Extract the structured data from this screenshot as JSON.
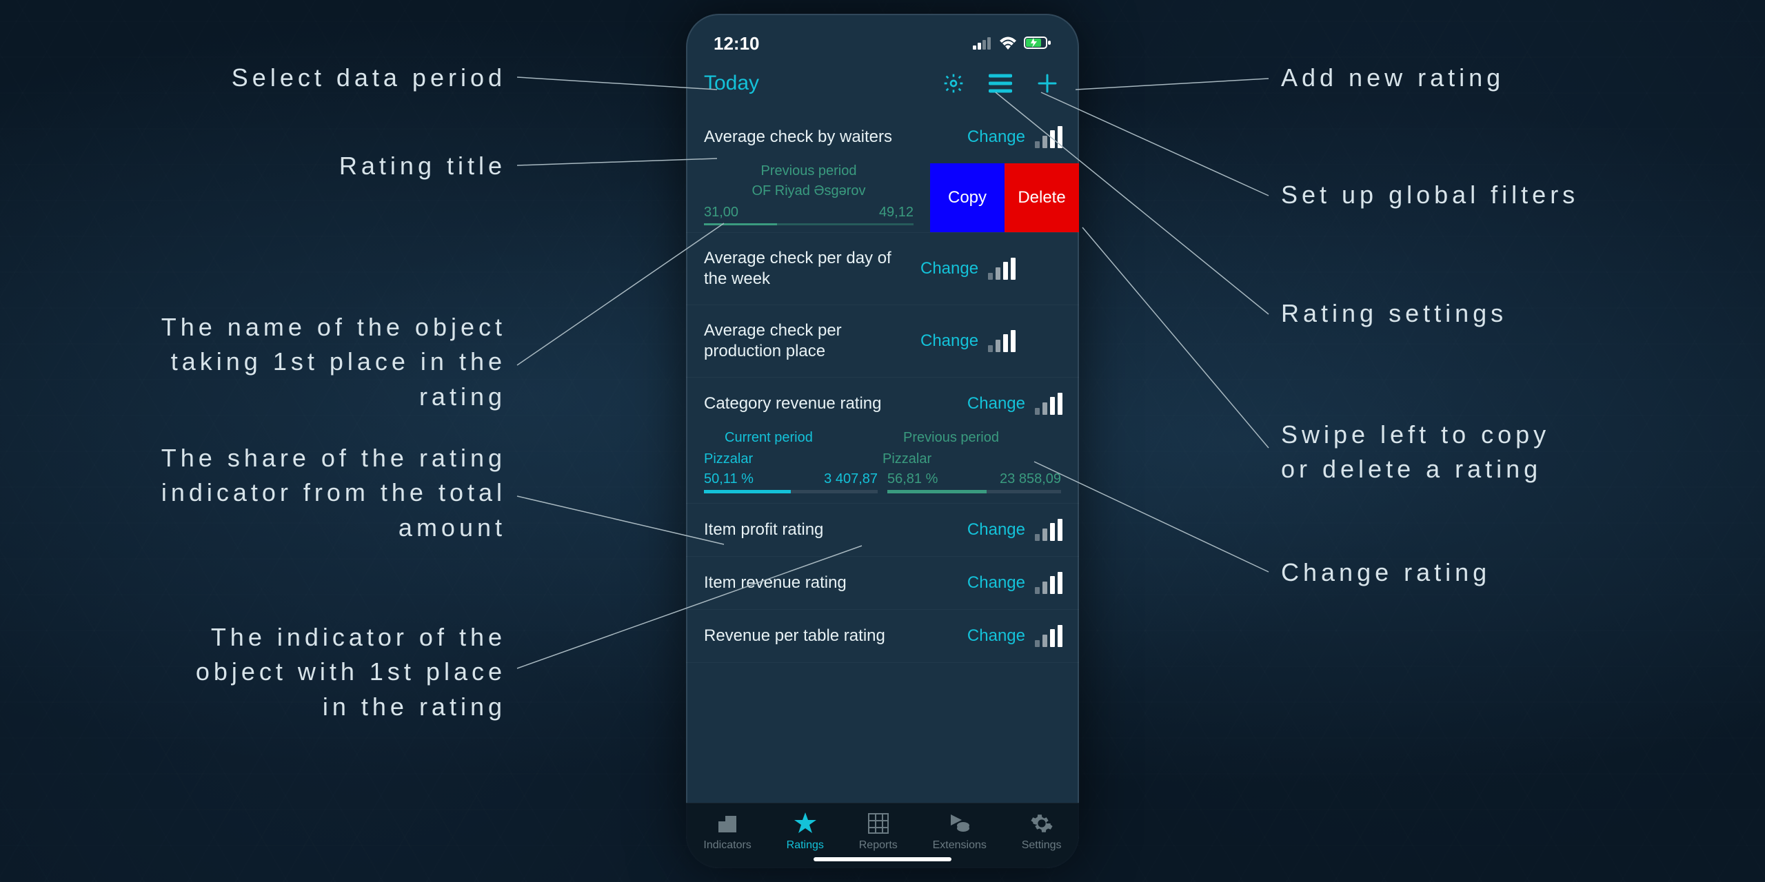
{
  "status": {
    "time": "12:10"
  },
  "header": {
    "period": "Today"
  },
  "swipe_actions": {
    "copy": "Copy",
    "delete": "Delete"
  },
  "ratings": [
    {
      "title": "Average check by waiters",
      "change": "Change"
    },
    {
      "title": "Average check per day of the week",
      "change": "Change"
    },
    {
      "title": "Average check per production place",
      "change": "Change"
    },
    {
      "title": "Category revenue rating",
      "change": "Change"
    },
    {
      "title": "Item profit rating",
      "change": "Change"
    },
    {
      "title": "Item revenue rating",
      "change": "Change"
    },
    {
      "title": "Revenue per table rating",
      "change": "Change"
    }
  ],
  "row0_detail": {
    "period_label": "Previous period",
    "object": "OF Riyad Əsgərov",
    "left_value": "31,00",
    "right_value": "49,12"
  },
  "category_detail": {
    "current_label": "Current period",
    "previous_label": "Previous period",
    "current_name": "Pizzalar",
    "previous_name": "Pizzalar",
    "current_pct": "50,11 %",
    "current_val": "3 407,87",
    "previous_pct": "56,81 %",
    "previous_val": "23 858,09"
  },
  "tabs": {
    "indicators": "Indicators",
    "ratings": "Ratings",
    "reports": "Reports",
    "extensions": "Extensions",
    "settings": "Settings"
  },
  "callouts": {
    "select_period": "Select data period",
    "rating_title": "Rating title",
    "object_name": "The name of the object\ntaking 1st place in the\nrating",
    "share": "The share of the rating\nindicator from the total\namount",
    "indicator": "The indicator of the\nobject with 1st place\nin the rating",
    "add_rating": "Add new rating",
    "global_filters": "Set up global filters",
    "rating_settings": "Rating settings",
    "swipe": "Swipe left to copy\nor delete a rating",
    "change_rating": "Change rating"
  }
}
